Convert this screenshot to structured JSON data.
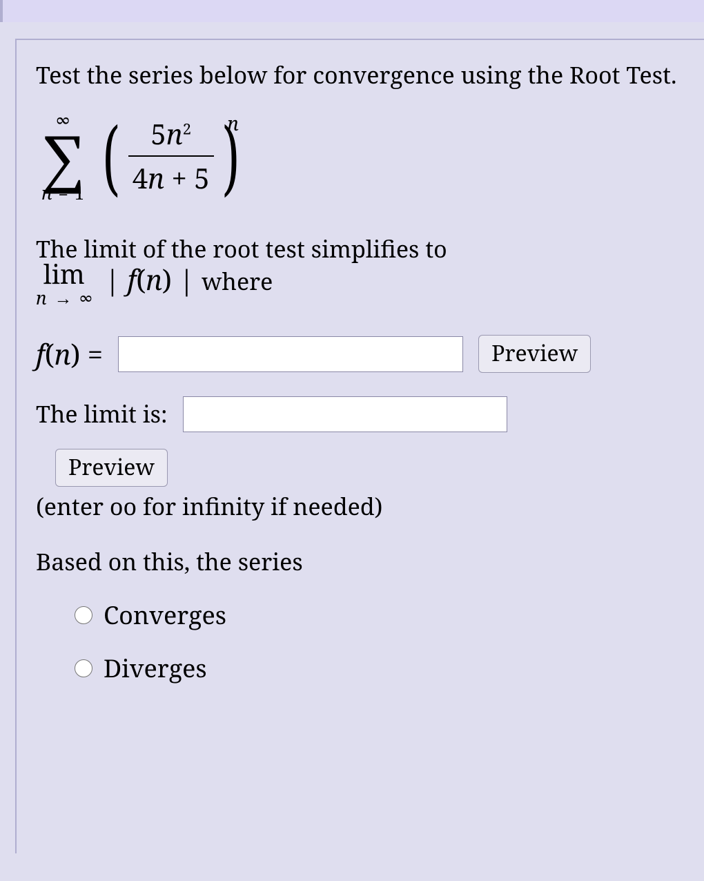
{
  "intro": "Test the series below for convergence using the Root Test.",
  "series": {
    "sigma_top": "∞",
    "sigma_bot_left": "n",
    "sigma_bot_eq": "=",
    "sigma_bot_right": "1",
    "frac_num_coef": "5",
    "frac_num_var": "n",
    "frac_num_pow": "2",
    "frac_den_coef": "4",
    "frac_den_var": "n",
    "frac_den_plus": " + 5",
    "exponent": "n"
  },
  "limit_text": "The limit of the root test simplifies to",
  "limit_expr": {
    "lim": "lim",
    "sub_left": "n",
    "sub_arrow": "→",
    "sub_right": "∞",
    "abs_open": "|",
    "f": "f",
    "paren_open": "(",
    "arg": "n",
    "paren_close": ")",
    "abs_close": "|",
    "after": " where"
  },
  "fn_row": {
    "label_f": "f",
    "label_open": "(",
    "label_arg": "n",
    "label_close": ")",
    "label_eq": " =",
    "input_value": "",
    "preview_btn": "Preview"
  },
  "limit_row": {
    "label": "The limit is:",
    "input_value": "",
    "preview_btn": "Preview",
    "hint": "(enter oo for infinity if needed)"
  },
  "conclusion_label": "Based on this, the series",
  "options": {
    "converges": "Converges",
    "diverges": "Diverges"
  }
}
